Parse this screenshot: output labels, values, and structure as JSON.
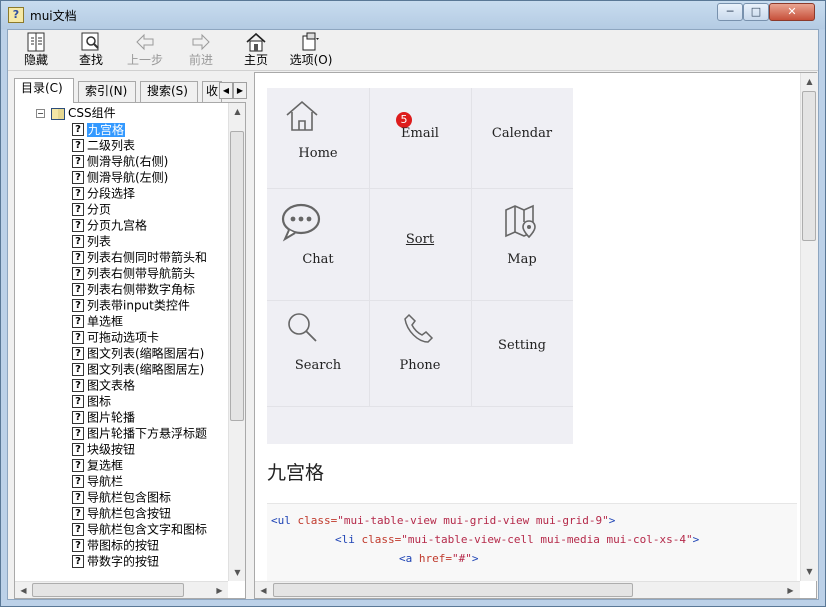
{
  "window": {
    "title": "mui文档",
    "icon": "help-file-icon",
    "controls": [
      "minimize-icon",
      "maximize-icon",
      "close-icon"
    ]
  },
  "toolbar": {
    "items": [
      {
        "label": "隐藏",
        "icon": "hide-pane-icon",
        "enabled": true
      },
      {
        "label": "查找",
        "icon": "find-icon",
        "enabled": true
      },
      {
        "label": "上一步",
        "icon": "back-arrow-icon",
        "enabled": false
      },
      {
        "label": "前进",
        "icon": "forward-arrow-icon",
        "enabled": false
      },
      {
        "label": "主页",
        "icon": "home-icon",
        "enabled": true
      },
      {
        "label": "选项(O)",
        "icon": "options-icon",
        "enabled": true
      }
    ]
  },
  "nav": {
    "tabs": [
      "目录(C)",
      "索引(N)",
      "搜索(S)",
      "收"
    ],
    "tree_root": "CSS组件",
    "items": [
      "九宫格",
      "二级列表",
      "侧滑导航(右侧)",
      "侧滑导航(左侧)",
      "分段选择",
      "分页",
      "分页九宫格",
      "列表",
      "列表右侧同时带箭头和",
      "列表右侧带导航箭头",
      "列表右侧带数字角标",
      "列表带input类控件",
      "单选框",
      "可拖动选项卡",
      "图文列表(缩略图居右)",
      "图文列表(缩略图居左)",
      "图文表格",
      "图标",
      "图片轮播",
      "图片轮播下方悬浮标题",
      "块级按钮",
      "复选框",
      "导航栏",
      "导航栏包含图标",
      "导航栏包含按钮",
      "导航栏包含文字和图标",
      "带图标的按钮",
      "带数字的按钮"
    ],
    "selected_index": 0
  },
  "grid": {
    "cells": [
      {
        "label": "Home",
        "icon": "home-icon"
      },
      {
        "label": "Email",
        "icon": "email-icon",
        "badge": "5"
      },
      {
        "label": "Calendar",
        "icon": "calendar-icon"
      },
      {
        "label": "Chat",
        "icon": "chat-icon"
      },
      {
        "label": "Sort",
        "icon": "sort-icon"
      },
      {
        "label": "Map",
        "icon": "map-icon"
      },
      {
        "label": "Search",
        "icon": "search-icon"
      },
      {
        "label": "Phone",
        "icon": "phone-icon"
      },
      {
        "label": "Setting",
        "icon": "setting-icon"
      }
    ]
  },
  "section_title": "九宫格",
  "code": {
    "line1": {
      "tag_open": "<ul ",
      "attr": "class=",
      "val": "\"mui-table-view mui-grid-view mui-grid-9\"",
      "tag_close": ">"
    },
    "line2": {
      "tag_open": "<li ",
      "attr": "class=",
      "val": "\"mui-table-view-cell mui-media mui-col-xs-4\"",
      "tag_close": ">"
    },
    "line3": {
      "tag_open": "<a ",
      "attr": "href=",
      "val": "\"#\"",
      "tag_close": ">"
    }
  }
}
